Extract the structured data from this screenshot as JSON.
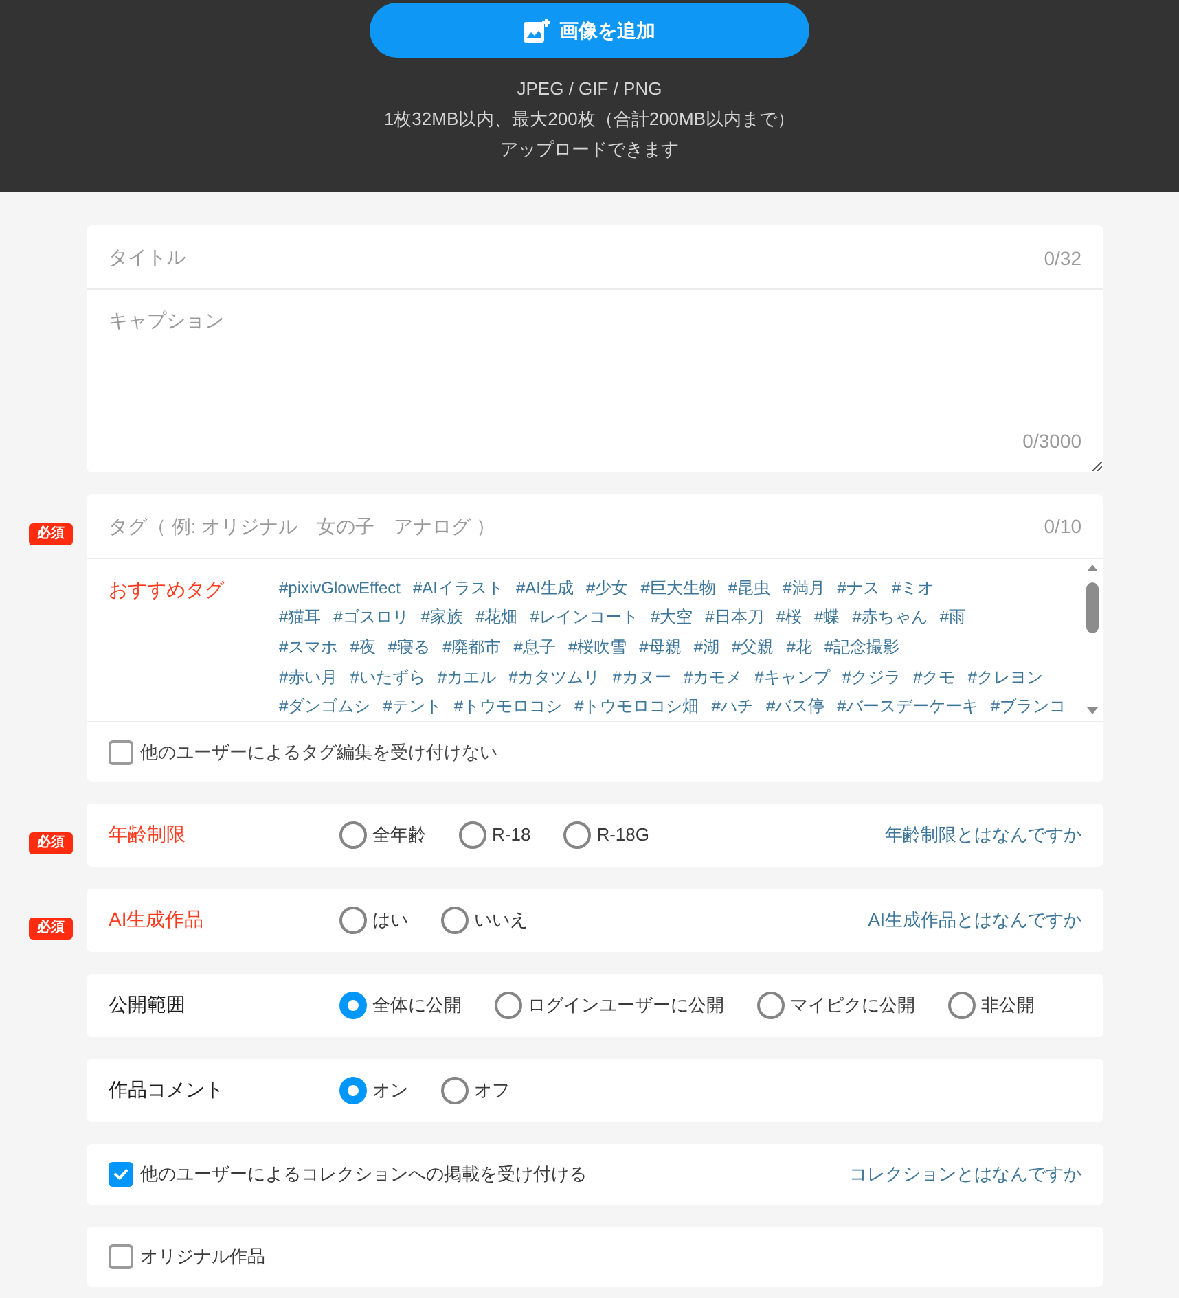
{
  "upload": {
    "button": "画像を追加",
    "formats": "JPEG / GIF / PNG",
    "size_limit": "1枚32MB以内、最大200枚（合計200MB以内まで）",
    "note": "アップロードできます"
  },
  "text_fields": {
    "title": {
      "placeholder": "タイトル",
      "counter": "0/32"
    },
    "caption": {
      "placeholder": "キャプション",
      "counter": "0/3000"
    }
  },
  "tags": {
    "required": true,
    "badge": "必須",
    "placeholder": "タグ（ 例: オリジナル　女の子　アナログ ）",
    "counter": "0/10",
    "recommended_label": "おすすめタグ",
    "recommended_rows": [
      [
        "#pixivGlowEffect",
        "#AIイラスト",
        "#AI生成",
        "#少女",
        "#巨大生物",
        "#昆虫",
        "#満月",
        "#ナス",
        "#ミオ"
      ],
      [
        "#猫耳",
        "#ゴスロリ",
        "#家族",
        "#花畑",
        "#レインコート",
        "#大空",
        "#日本刀",
        "#桜",
        "#蝶",
        "#赤ちゃん",
        "#雨"
      ],
      [
        "#スマホ",
        "#夜",
        "#寝る",
        "#廃都市",
        "#息子",
        "#桜吹雪",
        "#母親",
        "#湖",
        "#父親",
        "#花",
        "#記念撮影"
      ],
      [
        "#赤い月",
        "#いたずら",
        "#カエル",
        "#カタツムリ",
        "#カヌー",
        "#カモメ",
        "#キャンプ",
        "#クジラ",
        "#クモ",
        "#クレヨン"
      ],
      [
        "#ダンゴムシ",
        "#テント",
        "#トウモロコシ",
        "#トウモロコシ畑",
        "#ハチ",
        "#バス停",
        "#バースデーケーキ",
        "#ブランコ"
      ]
    ],
    "lock_option": {
      "label": "他のユーザーによるタグ編集を受け付けない",
      "checked": false
    }
  },
  "settings": [
    {
      "kind": "radio",
      "required": true,
      "badge": "必須",
      "label": "年齢制限",
      "options": [
        {
          "label": "全年齢",
          "selected": false
        },
        {
          "label": "R-18",
          "selected": false
        },
        {
          "label": "R-18G",
          "selected": false
        }
      ],
      "help_link": "年齢制限とはなんですか"
    },
    {
      "kind": "radio",
      "required": true,
      "badge": "必須",
      "label": "AI生成作品",
      "options": [
        {
          "label": "はい",
          "selected": false
        },
        {
          "label": "いいえ",
          "selected": false
        }
      ],
      "help_link": "AI生成作品とはなんですか"
    },
    {
      "kind": "radio",
      "required": false,
      "label": "公開範囲",
      "options": [
        {
          "label": "全体に公開",
          "selected": true
        },
        {
          "label": "ログインユーザーに公開",
          "selected": false
        },
        {
          "label": "マイピクに公開",
          "selected": false
        },
        {
          "label": "非公開",
          "selected": false
        }
      ]
    },
    {
      "kind": "radio",
      "required": false,
      "label": "作品コメント",
      "options": [
        {
          "label": "オン",
          "selected": true
        },
        {
          "label": "オフ",
          "selected": false
        }
      ]
    },
    {
      "kind": "checkbox",
      "label": "他のユーザーによるコレクションへの掲載を受け付ける",
      "checked": true,
      "help_link": "コレクションとはなんですか"
    },
    {
      "kind": "checkbox",
      "label": "オリジナル作品",
      "checked": false
    }
  ]
}
